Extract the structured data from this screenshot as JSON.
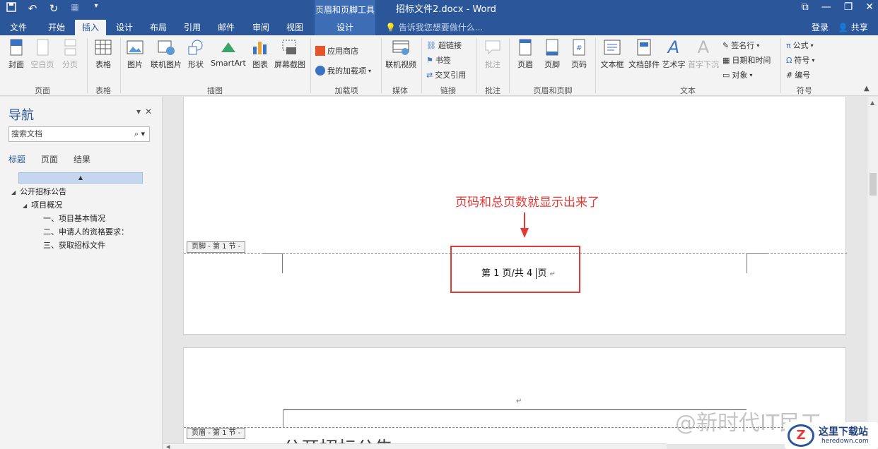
{
  "titlebar": {
    "context_tab_title": "页眉和页脚工具",
    "document_title": "招标文件2.docx - Word",
    "qat": [
      "save-icon",
      "undo-icon",
      "redo-icon",
      "touch-mode-icon",
      "customize-icon"
    ],
    "window_controls": [
      "ribbon-display-icon",
      "minimize-icon",
      "restore-icon",
      "close-icon"
    ]
  },
  "tabs": [
    "文件",
    "开始",
    "插入",
    "设计",
    "布局",
    "引用",
    "邮件",
    "审阅",
    "视图",
    "设计"
  ],
  "active_tab": "插入",
  "tell_me": "告诉我您想要做什么...",
  "login": "登录",
  "share": "共享",
  "ribbon": {
    "pages": {
      "cover": "封面",
      "blank_page": "空白页",
      "page_break": "分页",
      "group": "页面"
    },
    "tables": {
      "table": "表格",
      "group": "表格"
    },
    "illustrations": {
      "picture": "图片",
      "online_picture": "联机图片",
      "shapes": "形状",
      "smartart": "SmartArt",
      "chart": "图表",
      "screenshot": "屏幕截图",
      "group": "插图"
    },
    "addins": {
      "store": "应用商店",
      "my_addins": "我的加载项",
      "group": "加载项"
    },
    "media": {
      "online_video": "联机视频",
      "group": "媒体"
    },
    "links": {
      "hyperlink": "超链接",
      "bookmark": "书签",
      "cross_ref": "交叉引用",
      "group": "链接"
    },
    "comments": {
      "comment": "批注",
      "group": "批注"
    },
    "header_footer": {
      "header": "页眉",
      "footer": "页脚",
      "page_number": "页码",
      "group": "页眉和页脚"
    },
    "text": {
      "textbox": "文本框",
      "quick_parts": "文档部件",
      "wordart": "艺术字",
      "dropcap": "首字下沉",
      "signature": "签名行",
      "datetime": "日期和时间",
      "object": "对象",
      "group": "文本"
    },
    "symbols": {
      "equation": "公式",
      "symbol": "符号",
      "number": "编号",
      "group": "符号"
    }
  },
  "nav": {
    "title": "导航",
    "search_placeholder": "搜索文档",
    "tabs": [
      "标题",
      "页面",
      "结果"
    ],
    "tree": [
      {
        "level": 0,
        "label": "公开招标公告"
      },
      {
        "level": 1,
        "label": "项目概况"
      },
      {
        "level": 2,
        "label": "一、项目基本情况"
      },
      {
        "level": 2,
        "label": "二、申请人的资格要求："
      },
      {
        "level": 2,
        "label": "三、获取招标文件"
      }
    ]
  },
  "document": {
    "footer_tag": "页脚 - 第 1 节 -",
    "header_tag": "页眉 - 第 1 节 -",
    "annotation": "页码和总页数就显示出来了",
    "page_number_before": "第 1 页/共 4 ",
    "page_number_after": "页",
    "paragraph_mark": "↵",
    "next_heading": "公开招标公告"
  },
  "watermark": "@新时代IT民工",
  "logo": {
    "mark": "Z",
    "name": "这里下载站",
    "url": "heredown.com"
  },
  "colors": {
    "brand": "#2b579a",
    "annotation": "#e53935"
  }
}
